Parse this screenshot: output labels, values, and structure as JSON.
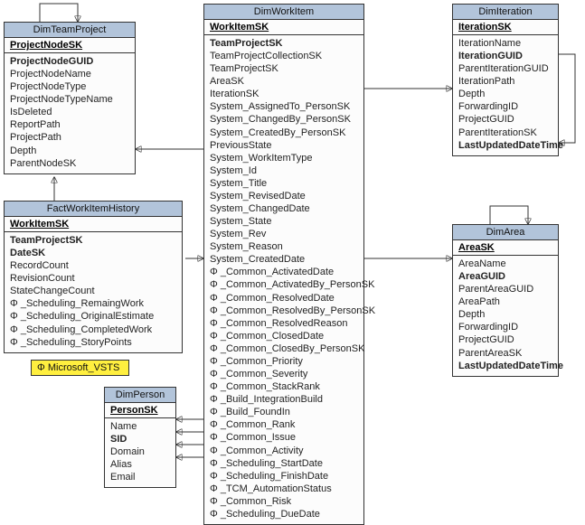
{
  "entities": {
    "dimTeamProject": {
      "title": "DimTeamProject",
      "pk": "ProjectNodeSK",
      "fields": [
        {
          "t": "ProjectNodeGUID",
          "b": true
        },
        {
          "t": "ProjectNodeName"
        },
        {
          "t": "ProjectNodeType"
        },
        {
          "t": "ProjectNodeTypeName"
        },
        {
          "t": "IsDeleted"
        },
        {
          "t": "ReportPath"
        },
        {
          "t": "ProjectPath"
        },
        {
          "t": "Depth"
        },
        {
          "t": "ParentNodeSK"
        }
      ]
    },
    "factWorkItemHistory": {
      "title": "FactWorkItemHistory",
      "pk": "WorkItemSK",
      "fields": [
        {
          "t": "TeamProjectSK",
          "b": true
        },
        {
          "t": "DateSK",
          "b": true
        },
        {
          "t": "RecordCount"
        },
        {
          "t": "RevisionCount"
        },
        {
          "t": "StateChangeCount"
        },
        {
          "t": "Φ _Scheduling_RemaingWork"
        },
        {
          "t": "Φ _Scheduling_OriginalEstimate"
        },
        {
          "t": "Φ _Scheduling_CompletedWork"
        },
        {
          "t": "Φ _Scheduling_StoryPoints"
        }
      ]
    },
    "dimWorkItem": {
      "title": "DimWorkItem",
      "pk": "WorkItemSK",
      "fields": [
        {
          "t": "TeamProjectSK",
          "b": true
        },
        {
          "t": "TeamProjectCollectionSK"
        },
        {
          "t": "TeamProjectSK"
        },
        {
          "t": "AreaSK"
        },
        {
          "t": "IterationSK"
        },
        {
          "t": "System_AssignedTo_PersonSK"
        },
        {
          "t": "System_ChangedBy_PersonSK"
        },
        {
          "t": "System_CreatedBy_PersonSK"
        },
        {
          "t": "PreviousState"
        },
        {
          "t": "System_WorkItemType"
        },
        {
          "t": "System_Id"
        },
        {
          "t": "System_Title"
        },
        {
          "t": "System_RevisedDate"
        },
        {
          "t": "System_ChangedDate"
        },
        {
          "t": "System_State"
        },
        {
          "t": "System_Rev"
        },
        {
          "t": "System_Reason"
        },
        {
          "t": "System_CreatedDate"
        },
        {
          "t": "Φ _Common_ActivatedDate"
        },
        {
          "t": "Φ _Common_ActivatedBy_PersonSK"
        },
        {
          "t": "Φ _Common_ResolvedDate"
        },
        {
          "t": "Φ _Common_ResolvedBy_PersonSK"
        },
        {
          "t": "Φ _Common_ResolvedReason"
        },
        {
          "t": "Φ _Common_ClosedDate"
        },
        {
          "t": "Φ _Common_ClosedBy_PersonSK"
        },
        {
          "t": "Φ _Common_Priority"
        },
        {
          "t": "Φ _Common_Severity"
        },
        {
          "t": "Φ _Common_StackRank"
        },
        {
          "t": "Φ _Build_IntegrationBuild"
        },
        {
          "t": "Φ _Build_FoundIn"
        },
        {
          "t": "Φ _Common_Rank"
        },
        {
          "t": "Φ _Common_Issue"
        },
        {
          "t": "Φ _Common_Activity"
        },
        {
          "t": "Φ _Scheduling_StartDate"
        },
        {
          "t": "Φ _Scheduling_FinishDate"
        },
        {
          "t": "Φ _TCM_AutomationStatus"
        },
        {
          "t": "Φ _Common_Risk"
        },
        {
          "t": "Φ _Scheduling_DueDate"
        }
      ]
    },
    "dimIteration": {
      "title": "DimIteration",
      "pk": "IterationSK",
      "fields": [
        {
          "t": "IterationName"
        },
        {
          "t": "IterationGUID",
          "b": true
        },
        {
          "t": "ParentIterationGUID"
        },
        {
          "t": "IterationPath"
        },
        {
          "t": "Depth"
        },
        {
          "t": "ForwardingID"
        },
        {
          "t": "ProjectGUID"
        },
        {
          "t": "ParentIterationSK"
        },
        {
          "t": "LastUpdatedDateTime",
          "b": true
        }
      ]
    },
    "dimArea": {
      "title": "DimArea",
      "pk": "AreaSK",
      "fields": [
        {
          "t": "AreaName"
        },
        {
          "t": "AreaGUID",
          "b": true
        },
        {
          "t": "ParentAreaGUID"
        },
        {
          "t": "AreaPath"
        },
        {
          "t": "Depth"
        },
        {
          "t": "ForwardingID"
        },
        {
          "t": "ProjectGUID"
        },
        {
          "t": "ParentAreaSK"
        },
        {
          "t": "LastUpdatedDateTime",
          "b": true
        }
      ]
    },
    "dimPerson": {
      "title": "DimPerson",
      "pk": "PersonSK",
      "fields": [
        {
          "t": "Name"
        },
        {
          "t": "SID",
          "b": true
        },
        {
          "t": "Domain"
        },
        {
          "t": "Alias"
        },
        {
          "t": "Email"
        }
      ]
    }
  },
  "legend": {
    "text": "Φ   Microsoft_VSTS"
  }
}
